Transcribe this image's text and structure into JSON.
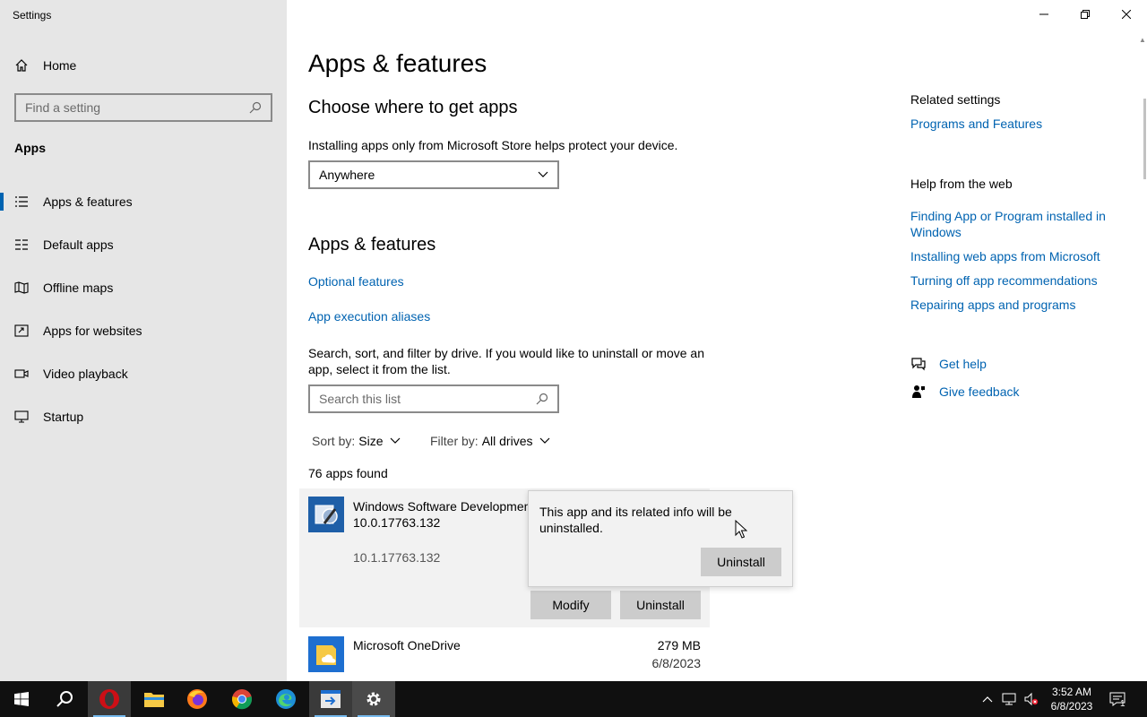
{
  "window": {
    "title": "Settings",
    "controls": {
      "minimize": "–",
      "restore": "❐",
      "close": "✕"
    }
  },
  "sidebar": {
    "home_label": "Home",
    "search_placeholder": "Find a setting",
    "section_label": "Apps",
    "items": [
      {
        "label": "Apps & features",
        "icon": "list-icon",
        "active": true
      },
      {
        "label": "Default apps",
        "icon": "default-apps-icon",
        "active": false
      },
      {
        "label": "Offline maps",
        "icon": "map-icon",
        "active": false
      },
      {
        "label": "Apps for websites",
        "icon": "web-link-icon",
        "active": false
      },
      {
        "label": "Video playback",
        "icon": "video-icon",
        "active": false
      },
      {
        "label": "Startup",
        "icon": "startup-icon",
        "active": false
      }
    ]
  },
  "main": {
    "page_title": "Apps & features",
    "choose_heading": "Choose where to get apps",
    "choose_desc": "Installing apps only from Microsoft Store helps protect your device.",
    "source_dropdown_value": "Anywhere",
    "features_heading": "Apps & features",
    "optional_features_link": "Optional features",
    "app_execution_aliases_link": "App execution aliases",
    "search_desc": "Search, sort, and filter by drive. If you would like to uninstall or move an app, select it from the list.",
    "search_placeholder": "Search this list",
    "sort_label": "Sort by:",
    "sort_value": "Size",
    "filter_label": "Filter by:",
    "filter_value": "All drives",
    "apps_count": "76 apps found",
    "apps": [
      {
        "name": "Windows Software Developmen",
        "subtitle": "10.0.17763.132",
        "version": "10.1.17763.132",
        "selected": true,
        "modify_label": "Modify",
        "uninstall_label": "Uninstall"
      },
      {
        "name": "Microsoft OneDrive",
        "size": "279 MB",
        "date": "6/8/2023",
        "selected": false
      }
    ],
    "flyout": {
      "message": "This app and its related info will be uninstalled.",
      "confirm_label": "Uninstall"
    }
  },
  "right": {
    "related_heading": "Related settings",
    "related_links": [
      "Programs and Features"
    ],
    "help_heading": "Help from the web",
    "help_links": [
      "Finding App or Program installed in Windows",
      "Installing web apps from Microsoft",
      "Turning off app recommendations",
      "Repairing apps and programs"
    ],
    "get_help": "Get help",
    "give_feedback": "Give feedback"
  },
  "taskbar": {
    "time": "3:52 AM",
    "date": "6/8/2023",
    "notification_count": "1",
    "apps": [
      "start",
      "search",
      "opera",
      "file-explorer",
      "firefox",
      "chrome",
      "edge",
      "remote-app",
      "settings"
    ],
    "accent_color": "#76b9ed"
  },
  "colors": {
    "link": "#0063b1",
    "sidebar_bg": "#e6e6e6",
    "button_bg": "#cccccc"
  }
}
